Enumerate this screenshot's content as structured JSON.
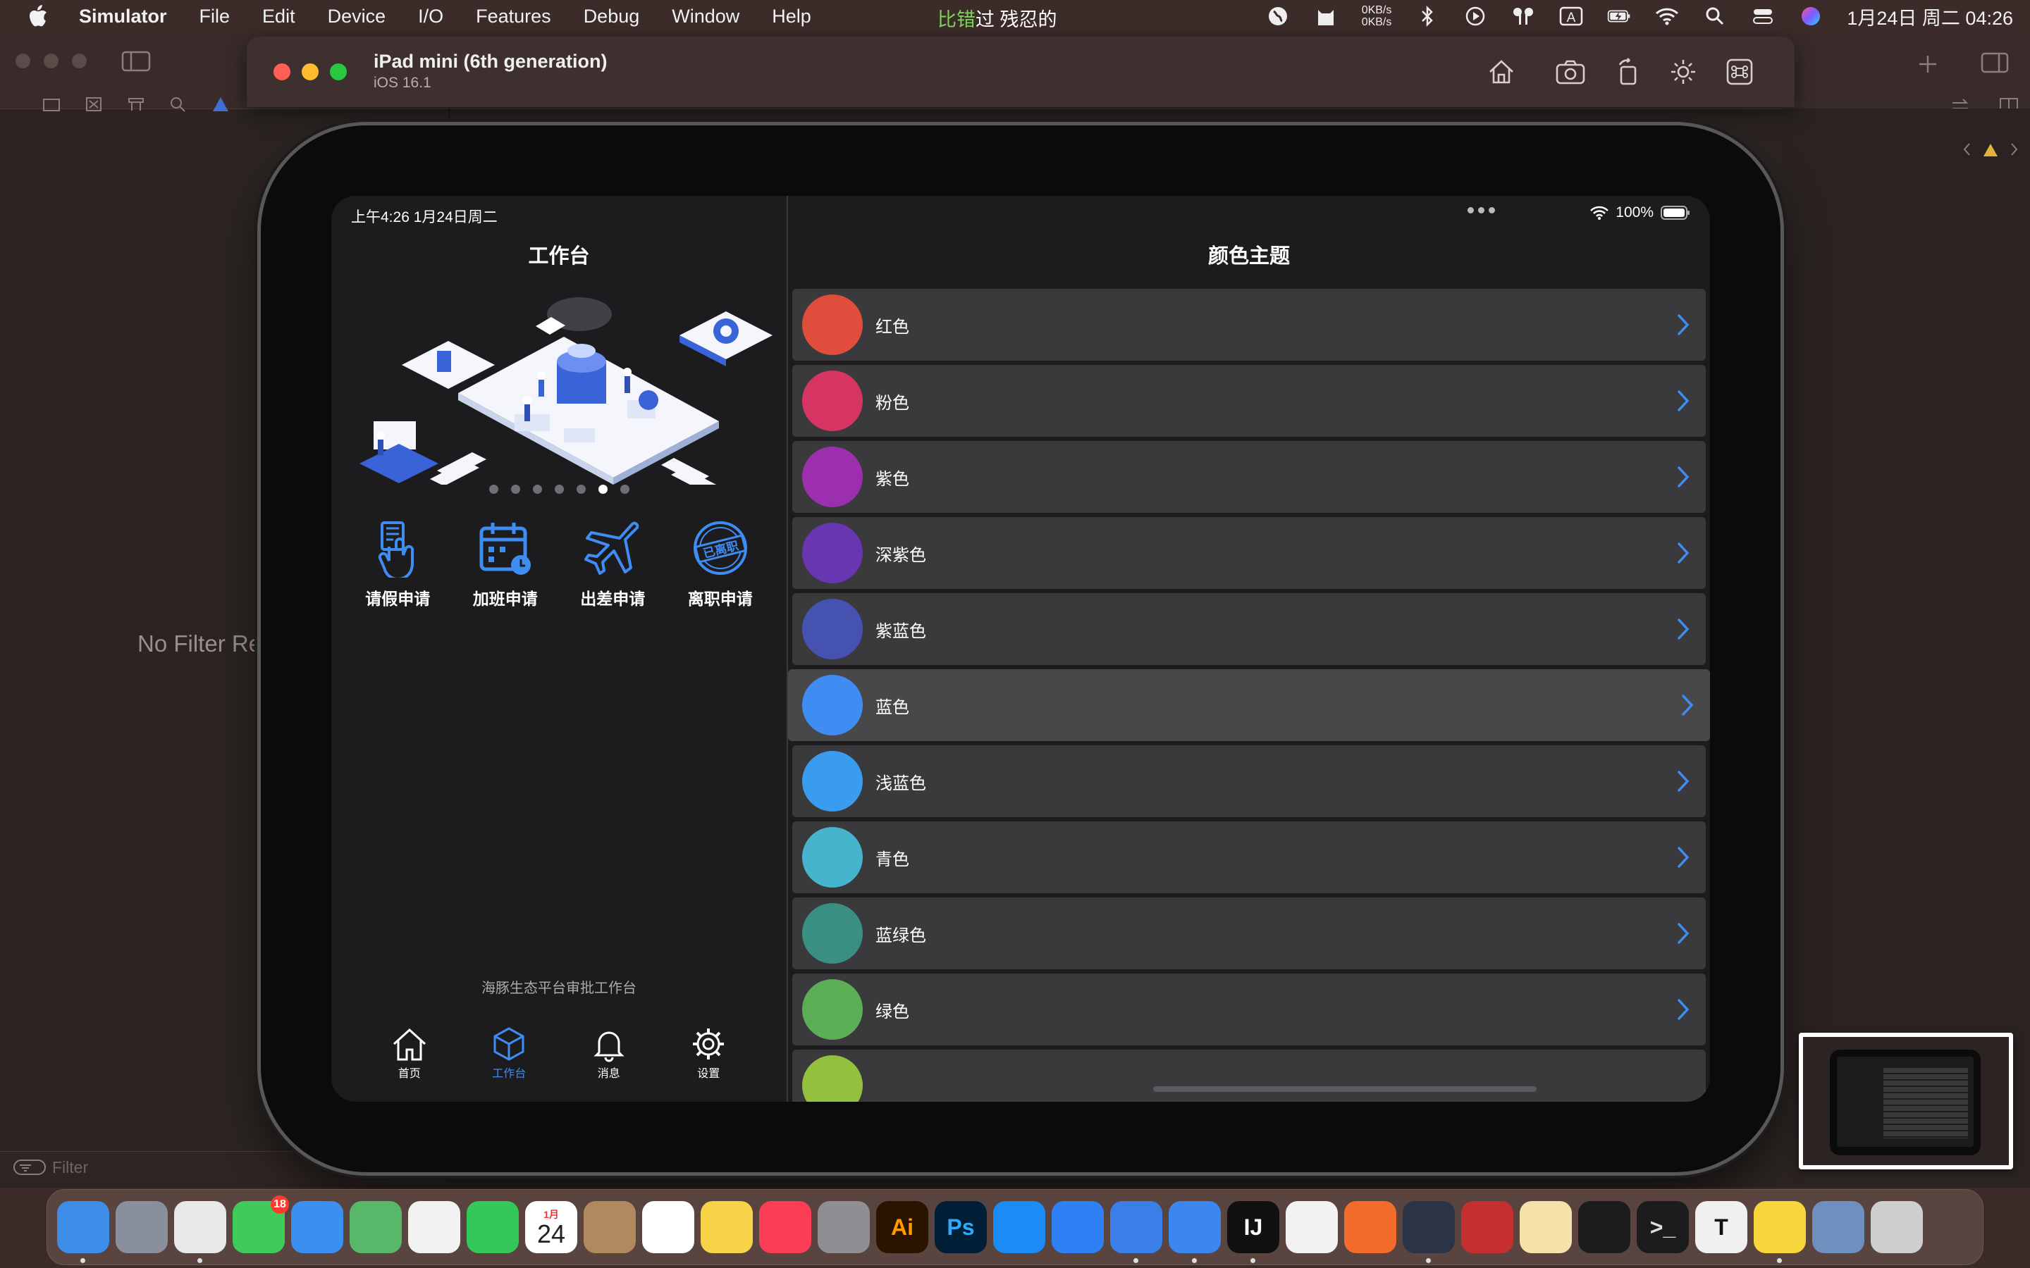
{
  "menubar": {
    "app_name": "Simulator",
    "items": [
      "File",
      "Edit",
      "Device",
      "I/O",
      "Features",
      "Debug",
      "Window",
      "Help"
    ],
    "ticker_prefix": "比错",
    "ticker_rest": "过 残忍的",
    "net_up": "0KB/s",
    "net_down": "0KB/s",
    "clock": "1月24日 周二  04:26",
    "icons": [
      "globe-icon",
      "cat-icon",
      "bluetooth-icon",
      "play-icon",
      "airpods-icon",
      "input-a-icon",
      "battery-icon",
      "wifi-icon",
      "search-icon",
      "control-center-icon",
      "siri-icon"
    ]
  },
  "xcode": {
    "no_filter": "No Filter Re",
    "filter_placeholder": "Filter"
  },
  "simulator": {
    "device_name": "iPad mini (6th generation)",
    "os_version": "iOS 16.1",
    "toolbar_icons": [
      "home-icon",
      "screenshot-icon",
      "rotate-icon",
      "appearance-icon",
      "command-icon"
    ]
  },
  "ipad": {
    "status_time": "上午4:26   1月24日周二",
    "battery": "100%",
    "left": {
      "title": "工作台",
      "pager_count": 7,
      "pager_active": 5,
      "quick_actions": [
        {
          "label": "请假申请",
          "icon": "leave-icon"
        },
        {
          "label": "加班申请",
          "icon": "overtime-calendar-icon"
        },
        {
          "label": "出差申请",
          "icon": "airplane-icon"
        },
        {
          "label": "离职申请",
          "icon": "resign-stamp-icon"
        }
      ],
      "stamp_text": "已离职",
      "footer": "海豚生态平台审批工作台",
      "tabs": [
        {
          "label": "首页",
          "icon": "home-icon",
          "active": false
        },
        {
          "label": "工作台",
          "icon": "cube-icon",
          "active": true
        },
        {
          "label": "消息",
          "icon": "bell-icon",
          "active": false
        },
        {
          "label": "设置",
          "icon": "gear-icon",
          "active": false
        }
      ]
    },
    "right": {
      "title": "颜色主题",
      "themes": [
        {
          "name": "红色",
          "color": "#e14d3d"
        },
        {
          "name": "粉色",
          "color": "#d63564"
        },
        {
          "name": "紫色",
          "color": "#9b2fae"
        },
        {
          "name": "深紫色",
          "color": "#6836b0"
        },
        {
          "name": "紫蓝色",
          "color": "#4552b0"
        },
        {
          "name": "蓝色",
          "color": "#3f8cf3"
        },
        {
          "name": "浅蓝色",
          "color": "#3a9cef"
        },
        {
          "name": "青色",
          "color": "#45b4cc"
        },
        {
          "name": "蓝绿色",
          "color": "#3a8f83"
        },
        {
          "name": "绿色",
          "color": "#5cae56"
        },
        {
          "name": "",
          "color": "#93c03f"
        }
      ],
      "highlighted_index": 5
    }
  },
  "dock": [
    {
      "name": "Finder",
      "color": "#3d8de8",
      "label": "",
      "running": true
    },
    {
      "name": "Launchpad",
      "color": "#8a8f9c",
      "label": "",
      "running": false
    },
    {
      "name": "Chrome",
      "color": "#e8e8e8",
      "label": "",
      "running": true
    },
    {
      "name": "Messages",
      "color": "#3ecb5a",
      "label": "",
      "badge": "18",
      "running": false
    },
    {
      "name": "Mail",
      "color": "#3b8ff0",
      "label": "",
      "running": false
    },
    {
      "name": "Maps",
      "color": "#58b86a",
      "label": "",
      "running": false
    },
    {
      "name": "Photos",
      "color": "#f2f2f2",
      "label": "",
      "running": false
    },
    {
      "name": "FaceTime",
      "color": "#34c759",
      "label": "",
      "running": false
    },
    {
      "name": "Calendar",
      "color": "#ffffff",
      "label": "24",
      "month": "1月",
      "running": false
    },
    {
      "name": "Contacts",
      "color": "#b08a5e",
      "label": "",
      "running": false
    },
    {
      "name": "Reminders",
      "color": "#ffffff",
      "label": "",
      "running": false
    },
    {
      "name": "Notes",
      "color": "#f7d34a",
      "label": "",
      "running": false
    },
    {
      "name": "Music",
      "color": "#fa3e55",
      "label": "",
      "running": false
    },
    {
      "name": "System Settings",
      "color": "#8e8e93",
      "label": "",
      "running": false
    },
    {
      "name": "Illustrator",
      "color": "#2a1400",
      "label": "Ai",
      "text_color": "#ff9a00",
      "running": false
    },
    {
      "name": "Photoshop",
      "color": "#001e36",
      "label": "Ps",
      "text_color": "#31a8ff",
      "running": false
    },
    {
      "name": "App Store",
      "color": "#1b8cf5",
      "label": "",
      "running": false
    },
    {
      "name": "Xcode Instruments",
      "color": "#2f7ff5",
      "label": "",
      "running": false
    },
    {
      "name": "Xcode",
      "color": "#3a7ee8",
      "label": "",
      "running": true
    },
    {
      "name": "Simulator",
      "color": "#3c86f0",
      "label": "",
      "running": true
    },
    {
      "name": "IntelliJ IDEA",
      "color": "#111111",
      "label": "IJ",
      "text_color": "#ffffff",
      "running": true
    },
    {
      "name": "Safari",
      "color": "#f2f2f2",
      "label": "",
      "running": false
    },
    {
      "name": "Paw",
      "color": "#f36c2c",
      "label": "",
      "running": false
    },
    {
      "name": "Cloud Sync",
      "color": "#2b3446",
      "label": "",
      "running": true
    },
    {
      "name": "DaVinci",
      "color": "#c62f2f",
      "label": "",
      "running": false
    },
    {
      "name": "Navicat",
      "color": "#f4e2a8",
      "label": "",
      "running": false
    },
    {
      "name": "Activity Monitor",
      "color": "#1c1c1e",
      "label": "",
      "running": false
    },
    {
      "name": "Terminal",
      "color": "#1c1c1e",
      "label": ">_",
      "text_color": "#dddddd",
      "running": false
    },
    {
      "name": "Typora",
      "color": "#f0f0f0",
      "label": "T",
      "text_color": "#111111",
      "running": false
    },
    {
      "name": "QQ Music",
      "color": "#f6d63a",
      "label": "",
      "running": true
    },
    {
      "name": "Preview",
      "color": "#6f8fbf",
      "label": "",
      "running": false
    },
    {
      "name": "Trash",
      "color": "#cfcfcf",
      "label": "",
      "running": false
    }
  ]
}
